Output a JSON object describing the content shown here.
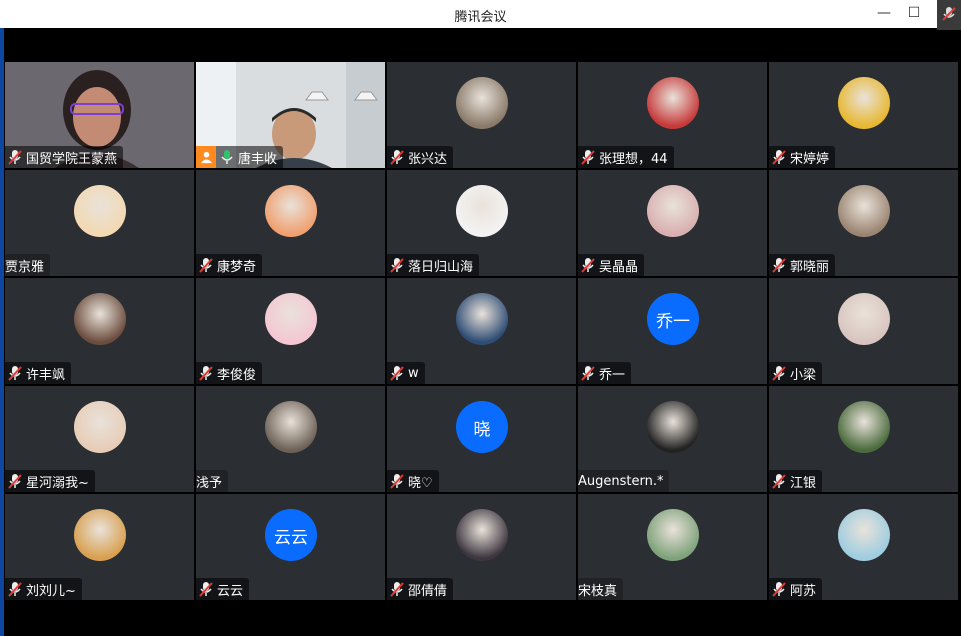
{
  "window": {
    "title": "腾讯会议",
    "minimize": "—",
    "maximize": "☐"
  },
  "participants": [
    {
      "name": "国贸学院王蒙燕",
      "kind": "video1",
      "muted": true
    },
    {
      "name": "唐丰收",
      "kind": "video2",
      "muted": false,
      "host": true,
      "active": true
    },
    {
      "name": "张兴达",
      "kind": "photo",
      "color": "#8a7a6a",
      "muted": true
    },
    {
      "name": "张理想，44",
      "kind": "photo",
      "color": "#c63a3a",
      "muted": true
    },
    {
      "name": "宋婷婷",
      "kind": "photo",
      "color": "#e8b830",
      "muted": true
    },
    {
      "name": "贾京雅",
      "kind": "photo",
      "color": "#f2d9b2",
      "muted": null
    },
    {
      "name": "康梦奇",
      "kind": "photo",
      "color": "#f0a070",
      "muted": true
    },
    {
      "name": "落日归山海",
      "kind": "photo",
      "color": "#f3f3f3",
      "muted": true
    },
    {
      "name": "吴晶晶",
      "kind": "photo",
      "color": "#d9b0b0",
      "muted": true
    },
    {
      "name": "郭晓丽",
      "kind": "photo",
      "color": "#9b8572",
      "muted": true
    },
    {
      "name": "许丰飒",
      "kind": "photo",
      "color": "#6b4d3e",
      "muted": true
    },
    {
      "name": "李俊俊",
      "kind": "photo",
      "color": "#f4c7d3",
      "muted": true
    },
    {
      "name": "w",
      "kind": "photo",
      "color": "#2e4c74",
      "muted": true
    },
    {
      "name": "乔一",
      "kind": "text",
      "avatar_text": "乔一",
      "muted": true
    },
    {
      "name": "小梁",
      "kind": "photo",
      "color": "#d9c5c0",
      "muted": true
    },
    {
      "name": "星河溺我~",
      "kind": "photo",
      "color": "#e7cdb7",
      "muted": true
    },
    {
      "name": "浅予",
      "kind": "photo",
      "color": "#6e6257",
      "muted": null
    },
    {
      "name": "晓♡",
      "kind": "text",
      "avatar_text": "晓",
      "muted": true
    },
    {
      "name": "Augenstern.*",
      "kind": "photo",
      "color": "#222222",
      "muted": null
    },
    {
      "name": "江银",
      "kind": "photo",
      "color": "#4b6b3d",
      "muted": true
    },
    {
      "name": "刘刘儿~",
      "kind": "photo",
      "color": "#d8a050",
      "muted": true
    },
    {
      "name": "云云",
      "kind": "text",
      "avatar_text": "云云",
      "muted": true
    },
    {
      "name": "邵倩倩",
      "kind": "photo",
      "color": "#3d3640",
      "muted": true
    },
    {
      "name": "宋枝真",
      "kind": "photo",
      "color": "#7ea27a",
      "muted": null
    },
    {
      "name": "阿苏",
      "kind": "photo",
      "color": "#9ecde0",
      "muted": true
    }
  ]
}
